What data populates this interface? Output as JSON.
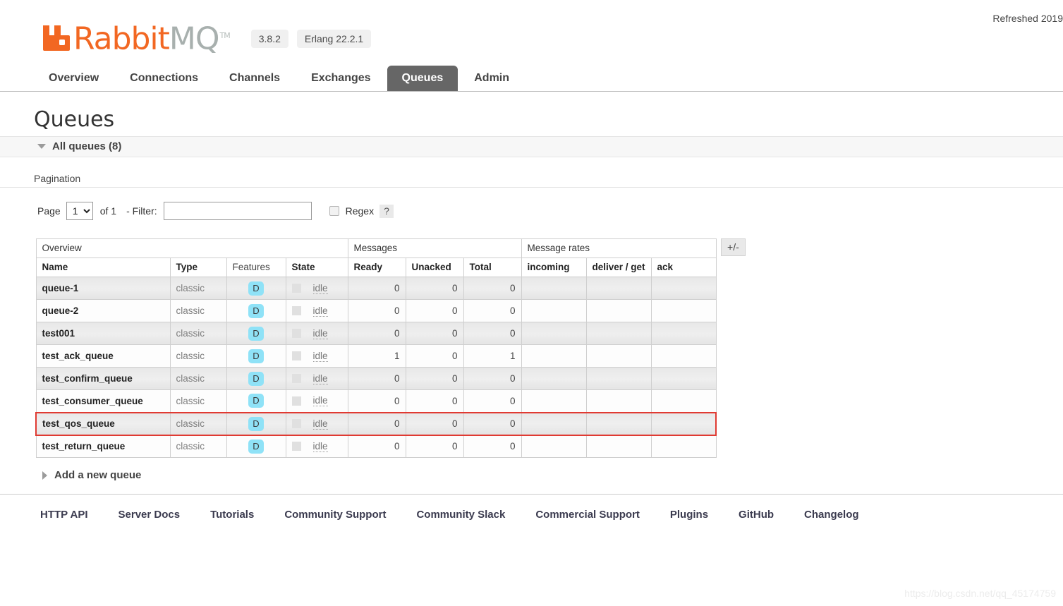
{
  "header": {
    "refreshed_text": "Refreshed 2019",
    "logo_orange": "Rabbit",
    "logo_grey": "MQ",
    "logo_tm": "TM",
    "version": "3.8.2",
    "erlang_version": "Erlang 22.2.1",
    "brand_color": "#f26722"
  },
  "nav": {
    "tabs": [
      {
        "label": "Overview",
        "active": false
      },
      {
        "label": "Connections",
        "active": false
      },
      {
        "label": "Channels",
        "active": false
      },
      {
        "label": "Exchanges",
        "active": false
      },
      {
        "label": "Queues",
        "active": true
      },
      {
        "label": "Admin",
        "active": false
      }
    ]
  },
  "main": {
    "page_title": "Queues",
    "all_queues_label": "All queues (8)",
    "pagination_label": "Pagination",
    "add_queue_label": "Add a new queue"
  },
  "pagination": {
    "page_label": "Page",
    "page_value": "1",
    "page_options": [
      "1"
    ],
    "of_label": "of 1",
    "filter_label": "- Filter:",
    "filter_value": "",
    "filter_placeholder": "",
    "regex_label": "Regex",
    "regex_checked": false,
    "help_label": "?"
  },
  "table": {
    "group_headers": [
      {
        "label": "Overview",
        "colspan": 4
      },
      {
        "label": "Messages",
        "colspan": 3
      },
      {
        "label": "Message rates",
        "colspan": 3
      }
    ],
    "columns": [
      {
        "label": "Name",
        "align": "left",
        "bold": true
      },
      {
        "label": "Type",
        "align": "left",
        "bold": true
      },
      {
        "label": "Features",
        "align": "left",
        "bold": false
      },
      {
        "label": "State",
        "align": "left",
        "bold": true
      },
      {
        "label": "Ready",
        "align": "left",
        "bold": true
      },
      {
        "label": "Unacked",
        "align": "left",
        "bold": true
      },
      {
        "label": "Total",
        "align": "left",
        "bold": true
      },
      {
        "label": "incoming",
        "align": "left",
        "bold": true
      },
      {
        "label": "deliver / get",
        "align": "left",
        "bold": true
      },
      {
        "label": "ack",
        "align": "left",
        "bold": true
      }
    ],
    "toggle_columns_label": "+/-",
    "rows": [
      {
        "name": "queue-1",
        "type": "classic",
        "features": "D",
        "state": "idle",
        "ready": "0",
        "unacked": "0",
        "total": "0",
        "incoming": "",
        "deliver_get": "",
        "ack": "",
        "highlighted": false
      },
      {
        "name": "queue-2",
        "type": "classic",
        "features": "D",
        "state": "idle",
        "ready": "0",
        "unacked": "0",
        "total": "0",
        "incoming": "",
        "deliver_get": "",
        "ack": "",
        "highlighted": false
      },
      {
        "name": "test001",
        "type": "classic",
        "features": "D",
        "state": "idle",
        "ready": "0",
        "unacked": "0",
        "total": "0",
        "incoming": "",
        "deliver_get": "",
        "ack": "",
        "highlighted": false
      },
      {
        "name": "test_ack_queue",
        "type": "classic",
        "features": "D",
        "state": "idle",
        "ready": "1",
        "unacked": "0",
        "total": "1",
        "incoming": "",
        "deliver_get": "",
        "ack": "",
        "highlighted": false
      },
      {
        "name": "test_confirm_queue",
        "type": "classic",
        "features": "D",
        "state": "idle",
        "ready": "0",
        "unacked": "0",
        "total": "0",
        "incoming": "",
        "deliver_get": "",
        "ack": "",
        "highlighted": false
      },
      {
        "name": "test_consumer_queue",
        "type": "classic",
        "features": "D",
        "state": "idle",
        "ready": "0",
        "unacked": "0",
        "total": "0",
        "incoming": "",
        "deliver_get": "",
        "ack": "",
        "highlighted": false
      },
      {
        "name": "test_qos_queue",
        "type": "classic",
        "features": "D",
        "state": "idle",
        "ready": "0",
        "unacked": "0",
        "total": "0",
        "incoming": "",
        "deliver_get": "",
        "ack": "",
        "highlighted": true
      },
      {
        "name": "test_return_queue",
        "type": "classic",
        "features": "D",
        "state": "idle",
        "ready": "0",
        "unacked": "0",
        "total": "0",
        "incoming": "",
        "deliver_get": "",
        "ack": "",
        "highlighted": false
      }
    ],
    "highlight_color": "#e03a32"
  },
  "footer": {
    "links": [
      "HTTP API",
      "Server Docs",
      "Tutorials",
      "Community Support",
      "Community Slack",
      "Commercial Support",
      "Plugins",
      "GitHub",
      "Changelog"
    ]
  },
  "watermark": {
    "text": "https://blog.csdn.net/qq_45174759"
  }
}
